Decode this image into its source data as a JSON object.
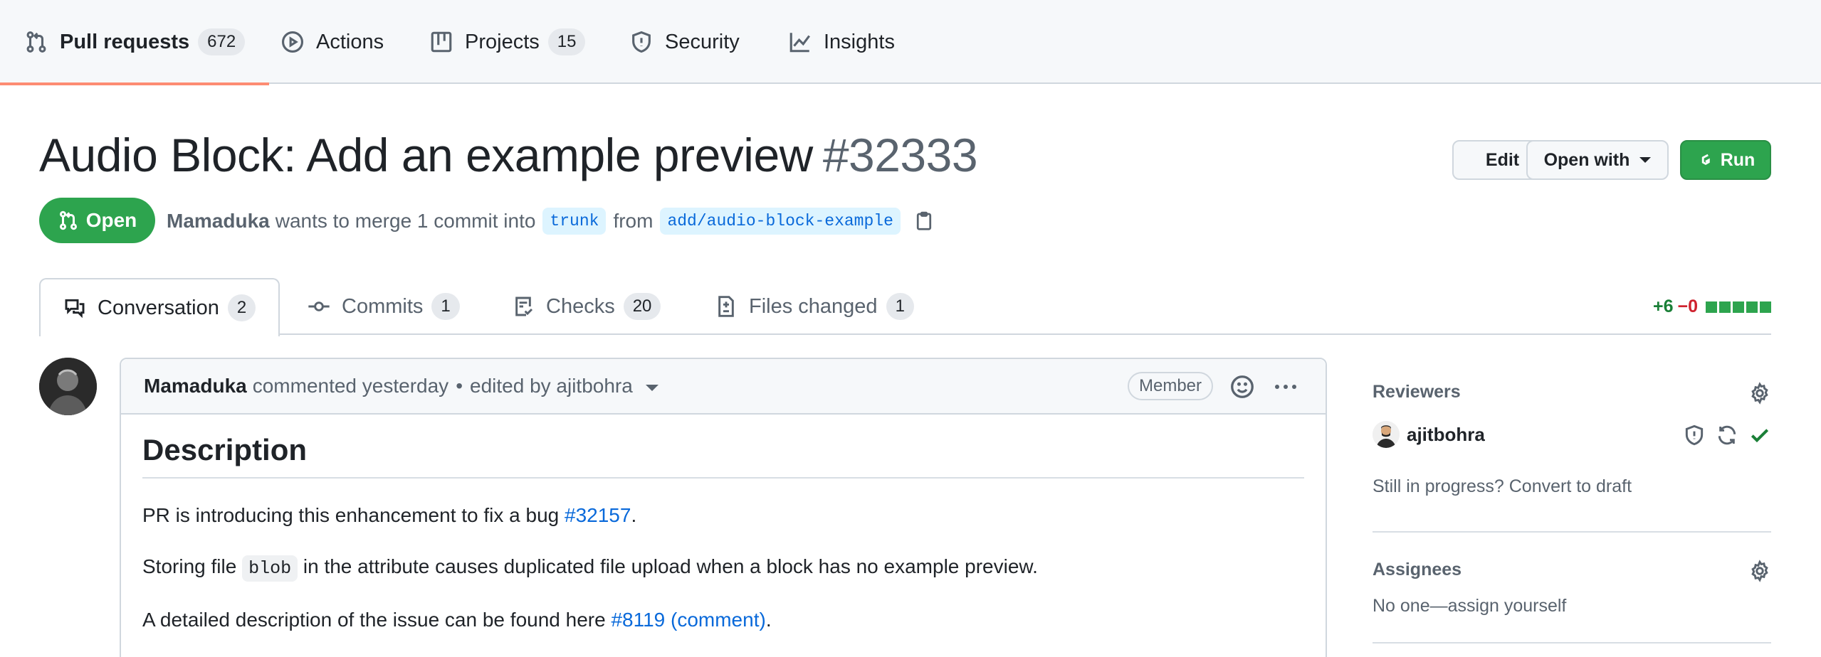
{
  "repo_nav": [
    {
      "label": "Pull requests",
      "count": "672",
      "icon": "git-pull-request-icon",
      "selected": true
    },
    {
      "label": "Actions",
      "icon": "play-icon"
    },
    {
      "label": "Projects",
      "count": "15",
      "icon": "table-icon"
    },
    {
      "label": "Security",
      "icon": "shield-icon"
    },
    {
      "label": "Insights",
      "icon": "graph-icon"
    }
  ],
  "pr": {
    "title": "Audio Block: Add an example preview",
    "number": "#32333",
    "state": "Open",
    "author": "Mamaduka",
    "merge_text": "wants to merge 1 commit into",
    "base_branch": "trunk",
    "from_text": "from",
    "head_branch": "add/audio-block-example"
  },
  "header_buttons": {
    "edit": "Edit",
    "open_with": "Open with",
    "run": "Run"
  },
  "tabs": [
    {
      "label": "Conversation",
      "count": "2",
      "icon": "comment-discussion-icon",
      "active": true
    },
    {
      "label": "Commits",
      "count": "1",
      "icon": "git-commit-icon"
    },
    {
      "label": "Checks",
      "count": "20",
      "icon": "checklist-icon"
    },
    {
      "label": "Files changed",
      "count": "1",
      "icon": "file-diff-icon"
    }
  ],
  "diffstat": {
    "additions": "+6",
    "deletions": "−0",
    "blocks_added": 5
  },
  "comment": {
    "author": "Mamaduka",
    "action": "commented yesterday",
    "separator": "•",
    "edited": "edited by ajitbohra",
    "role_badge": "Member",
    "heading": "Description",
    "p1_text": "PR is introducing this enhancement to fix a bug ",
    "p1_link": "#32157",
    "p1_end": ".",
    "p2_pre": "Storing file ",
    "p2_code": "blob",
    "p2_post": " in the attribute causes duplicated file upload when a block has no example preview.",
    "p3_text": "A detailed description of the issue can be found here ",
    "p3_link": "#8119 (comment)",
    "p3_end": "."
  },
  "sidebar": {
    "reviewers_heading": "Reviewers",
    "reviewer_name": "ajitbohra",
    "convert_text": "Still in progress? Convert to draft",
    "assignees_heading": "Assignees",
    "assignees_text": "No one—assign yourself"
  },
  "colors": {
    "open_green": "#2da44e",
    "link_blue": "#0969da",
    "nav_underline": "#fd8c73",
    "deletion_red": "#cf222e"
  }
}
